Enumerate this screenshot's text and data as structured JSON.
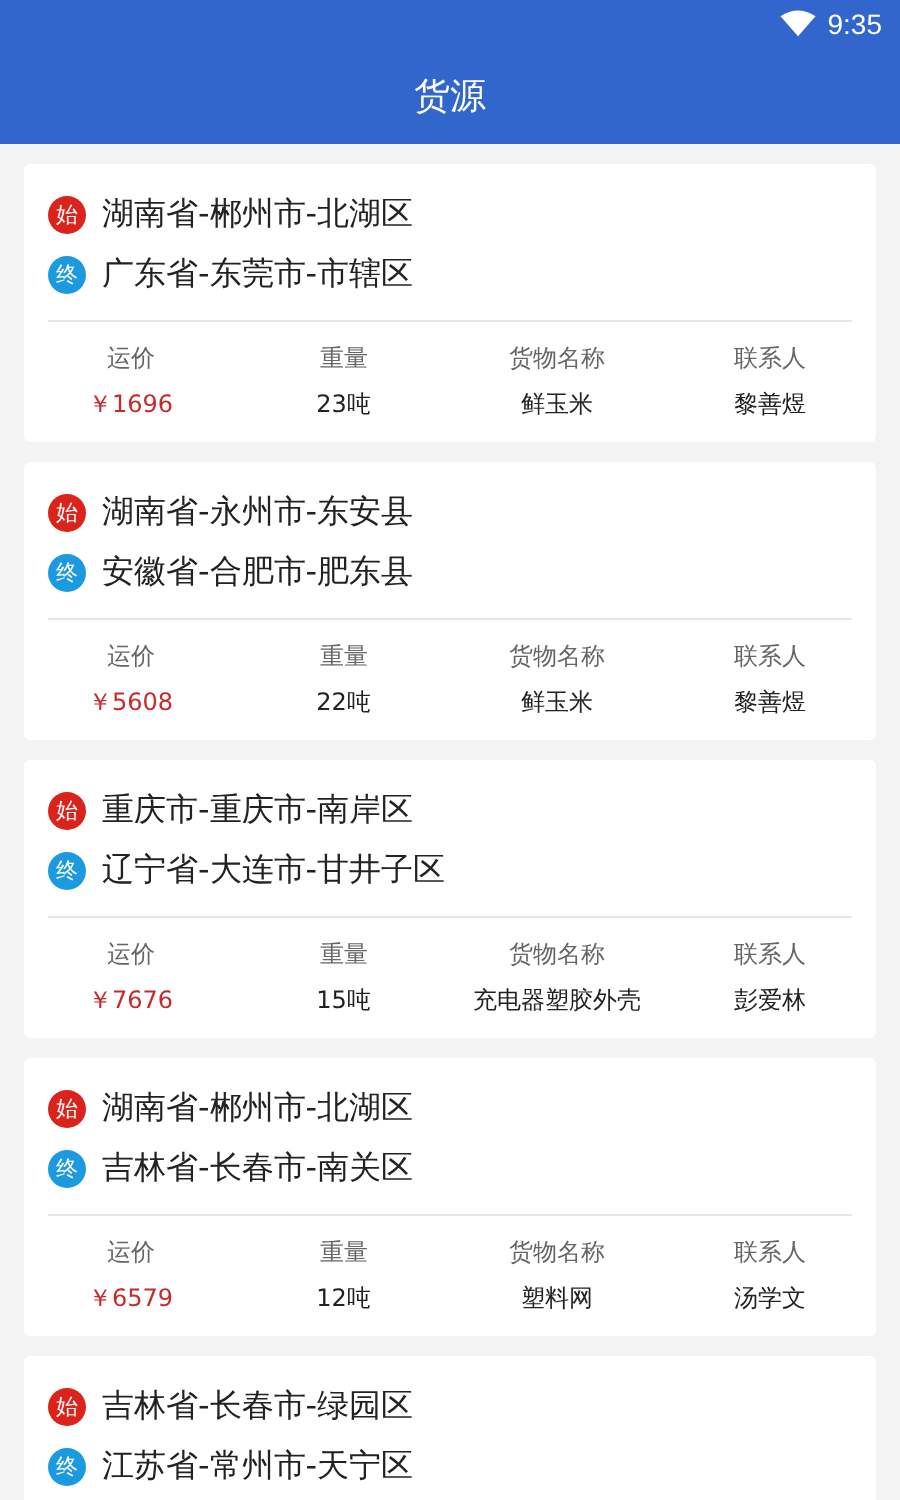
{
  "status_bar": {
    "time": "9:35"
  },
  "header": {
    "title": "货源"
  },
  "cards": [
    {
      "route": [
        {
          "kind": "start",
          "badge": "始",
          "place": "湖南省-郴州市-北湖区"
        },
        {
          "kind": "end",
          "badge": "终",
          "place": "广东省-东莞市-市辖区"
        }
      ],
      "stats": [
        {
          "kind": "price",
          "label": "运价",
          "value": "￥1696"
        },
        {
          "kind": "plain",
          "label": "重量",
          "value": "23吨"
        },
        {
          "kind": "plain",
          "label": "货物名称",
          "value": "鲜玉米"
        },
        {
          "kind": "plain",
          "label": "联系人",
          "value": "黎善煜"
        }
      ]
    },
    {
      "route": [
        {
          "kind": "start",
          "badge": "始",
          "place": "湖南省-永州市-东安县"
        },
        {
          "kind": "end",
          "badge": "终",
          "place": "安徽省-合肥市-肥东县"
        }
      ],
      "stats": [
        {
          "kind": "price",
          "label": "运价",
          "value": "￥5608"
        },
        {
          "kind": "plain",
          "label": "重量",
          "value": "22吨"
        },
        {
          "kind": "plain",
          "label": "货物名称",
          "value": "鲜玉米"
        },
        {
          "kind": "plain",
          "label": "联系人",
          "value": "黎善煜"
        }
      ]
    },
    {
      "route": [
        {
          "kind": "start",
          "badge": "始",
          "place": "重庆市-重庆市-南岸区"
        },
        {
          "kind": "end",
          "badge": "终",
          "place": "辽宁省-大连市-甘井子区"
        }
      ],
      "stats": [
        {
          "kind": "price",
          "label": "运价",
          "value": "￥7676"
        },
        {
          "kind": "plain",
          "label": "重量",
          "value": "15吨"
        },
        {
          "kind": "plain",
          "label": "货物名称",
          "value": "充电器塑胶外壳"
        },
        {
          "kind": "plain",
          "label": "联系人",
          "value": "彭爱林"
        }
      ]
    },
    {
      "route": [
        {
          "kind": "start",
          "badge": "始",
          "place": "湖南省-郴州市-北湖区"
        },
        {
          "kind": "end",
          "badge": "终",
          "place": "吉林省-长春市-南关区"
        }
      ],
      "stats": [
        {
          "kind": "price",
          "label": "运价",
          "value": "￥6579"
        },
        {
          "kind": "plain",
          "label": "重量",
          "value": "12吨"
        },
        {
          "kind": "plain",
          "label": "货物名称",
          "value": "塑料网"
        },
        {
          "kind": "plain",
          "label": "联系人",
          "value": "汤学文"
        }
      ]
    },
    {
      "route": [
        {
          "kind": "start",
          "badge": "始",
          "place": "吉林省-长春市-绿园区"
        },
        {
          "kind": "end",
          "badge": "终",
          "place": "江苏省-常州市-天宁区"
        }
      ]
    }
  ]
}
